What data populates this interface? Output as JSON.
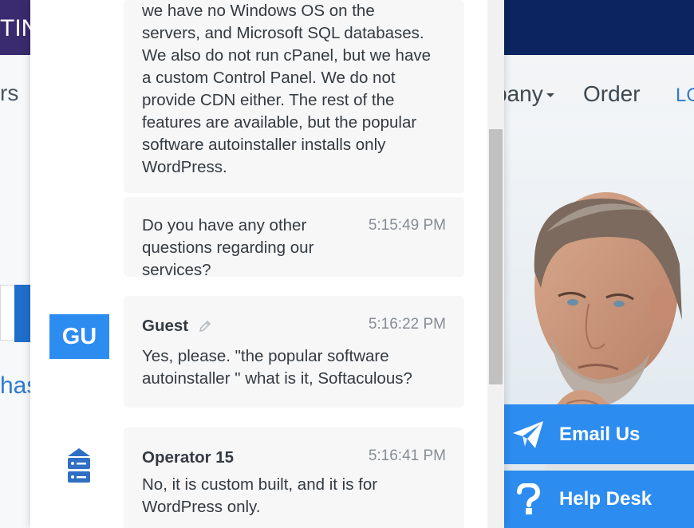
{
  "site": {
    "logo_fragment": "TIN",
    "nav_fragment_left": "rs",
    "nav_company": "pany",
    "nav_order": "Order",
    "nav_login": "LO",
    "hero_fragment": "has"
  },
  "side_buttons": {
    "email_label": "Email Us",
    "help_label": "Help Desk"
  },
  "chat": {
    "messages": [
      {
        "lines": [
          "we have no Windows OS on the",
          "servers, and Microsoft SQL databases.",
          "We also do not run cPanel, but we have",
          "a custom Control Panel. We do not",
          "provide CDN either. The rest of the",
          "features are available, but the popular",
          "software autoinstaller installs only",
          "WordPress."
        ]
      },
      {
        "text": "Do you have any other questions regarding our services?",
        "time": "5:15:49 PM"
      },
      {
        "author": "Guest",
        "avatar": "GU",
        "time": "5:16:22 PM",
        "text": "Yes, please. \"the popular software autoinstaller \" what is it, Softaculous?"
      },
      {
        "author": "Operator 15",
        "time": "5:16:41 PM",
        "text": "No, it is custom built, and it is for WordPress only."
      }
    ]
  },
  "colors": {
    "accent": "#2d8cf0",
    "banner": "#0c2560",
    "bubble_bg": "#f7f7f8",
    "operator_icon": "#2f6fc4"
  },
  "icons": [
    "pencil-icon",
    "server-icon",
    "paper-plane-icon",
    "question-mark-icon"
  ]
}
